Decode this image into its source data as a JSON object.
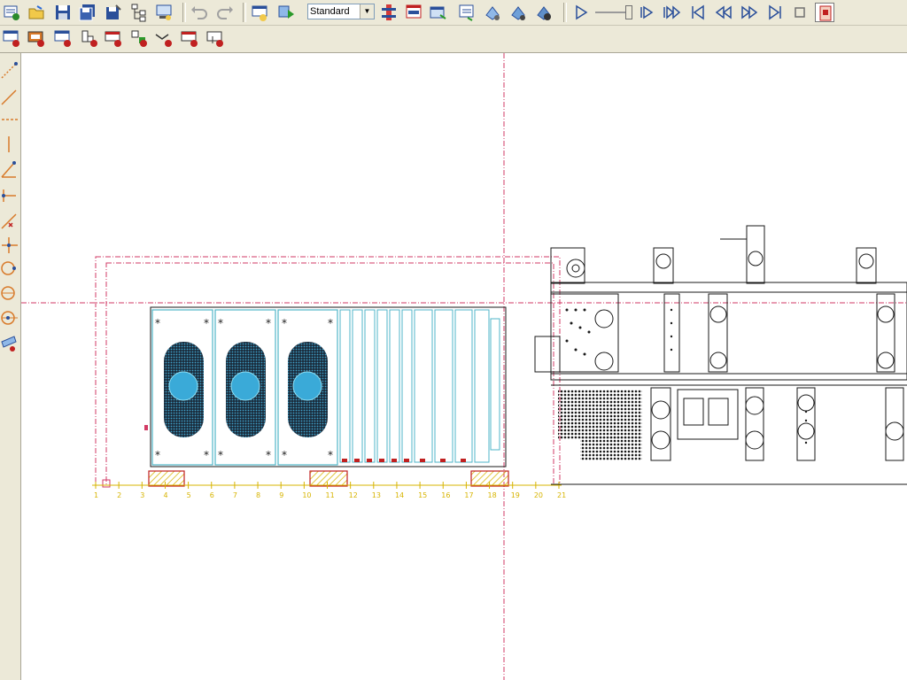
{
  "toolbar1": {
    "view_mode": "Standard",
    "icons": [
      "new-icon",
      "open-icon",
      "save-icon",
      "save-all-icon",
      "save-as-icon",
      "tree-icon",
      "print-icon",
      "undo-icon",
      "redo-icon",
      "table-icon",
      "run-icon",
      "view-mode-select",
      "column-icon",
      "dialog-icon",
      "window-icon",
      "export-icon",
      "rotate-icon",
      "rotate-right-icon",
      "settings-icon",
      "play-icon",
      "speed-slider",
      "step-forward-icon",
      "fast-forward-icon",
      "go-start-icon",
      "rewind-icon",
      "forward-icon",
      "go-end-icon",
      "stop-icon",
      "record-icon"
    ]
  },
  "toolbar2": {
    "icons": [
      "table-new-icon",
      "frame-icon",
      "grid-icon",
      "component-icon",
      "window-add-icon",
      "move-icon",
      "route-icon",
      "panel-icon",
      "panel-edit-icon"
    ]
  },
  "leftbar": {
    "icons": [
      "draw-line-icon",
      "diagonal-icon",
      "horizontal-dash-icon",
      "vertical-line-icon",
      "angle-icon",
      "dimension-icon",
      "cut-icon",
      "node-icon",
      "rectangle-icon",
      "circle-icon",
      "ellipse-icon",
      "measure-icon"
    ]
  },
  "colors": {
    "background": "#ece9d8",
    "canvas": "#ffffff",
    "guide_line": "#d23a64",
    "cyan_outline": "#4fb6c8",
    "fan_blue": "#3aaad8",
    "ruler": "#d7b400",
    "hatch_red": "#c02020"
  },
  "canvas": {
    "ruler_numbers": [
      "1",
      "2",
      "3",
      "4",
      "5",
      "6",
      "7",
      "8",
      "9",
      "10",
      "11",
      "12",
      "13",
      "14",
      "15",
      "16",
      "17",
      "18",
      "19",
      "20",
      "21"
    ]
  }
}
